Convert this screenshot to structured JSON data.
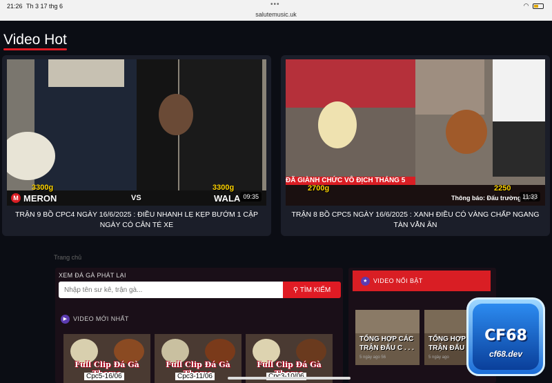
{
  "status": {
    "time": "21:26",
    "date": "Th 3 17 thg 6",
    "url": "salutemusic.uk",
    "battery": ""
  },
  "hot": {
    "title": "Video Hot"
  },
  "videos": [
    {
      "duration": "09:35",
      "caption": "TRẬN 9 BỒ CPC4 NGÀY 16/6/2025 : ĐIỀU NHANH LẸ KẸP BƯỚM 1 CẬP NGÀY CÓ CÂN TÉ XE",
      "left_weight": "3300g",
      "right_weight": "3300g",
      "left_name": "MERON",
      "vs": "VS",
      "right_name": "WALA",
      "badge": "M"
    },
    {
      "duration": "11:33",
      "caption": "TRẬN 8 BỒ CPC5 NGÀY 16/6/2025 : XANH ĐIỀU CÓ VÀNG CHẤP NGANG TÀN VẪN ĂN",
      "left_weight": "2700g",
      "right_weight": "2250",
      "banner": "ĐÃ GIÀNH CHỨC VÔ ĐỊCH THÁNG 5",
      "notice": "Thông báo: Đấu trường CPC"
    }
  ],
  "breadcrumb": {
    "home": "Trang chủ"
  },
  "replay": {
    "title": "XEM ĐÁ GÀ PHÁT LẠI",
    "search_placeholder": "Nhập tên sư kê, trận gà...",
    "search_button": "TÌM KIẾM",
    "latest_label": "VIDEO MỚI NHẤT",
    "thumbs": [
      {
        "title": "Full Clip Đá Gà Thomo",
        "tag": "Cpc5-16/06"
      },
      {
        "title": "Full Clip Đá Gà Thomo",
        "tag": "Cpc3-11/06"
      },
      {
        "title": "Full Clip Đá Gà Thomo",
        "tag": "Cpc3-10/06"
      }
    ]
  },
  "featured": {
    "title": "VIDEO NỔI BẬT",
    "items": [
      {
        "title": "TỔNG HỢP CÁC TRẬN ĐẤU C . . .",
        "meta": "5 ngày ago  56"
      },
      {
        "title": "TỔNG HỢP C... TRẬN ĐẤU C...",
        "meta": "5 ngày ago"
      }
    ]
  },
  "logo": {
    "brand": "CF68",
    "site": "cf68.dev"
  }
}
